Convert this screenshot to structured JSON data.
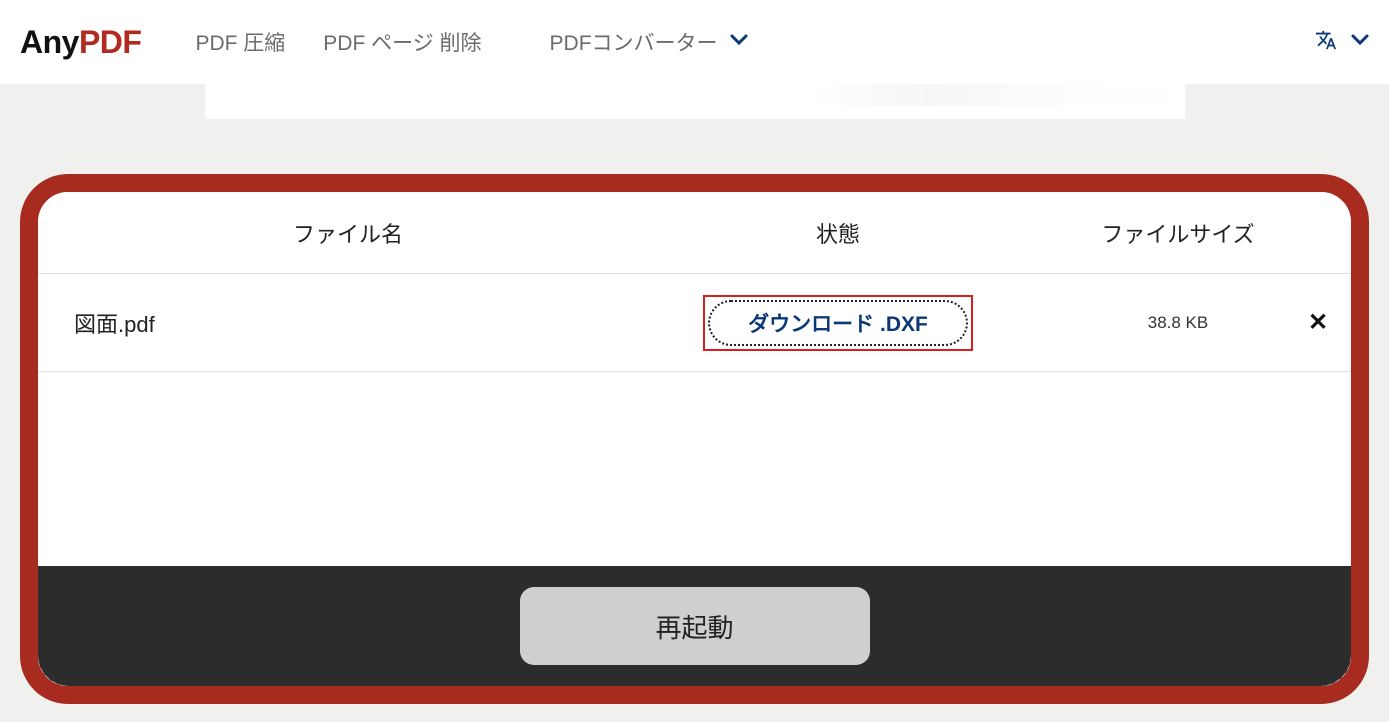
{
  "logo": {
    "part1": "Any",
    "part2": "PDF"
  },
  "nav": {
    "compress": "PDF 圧縮",
    "delete_pages": "PDF ページ 削除",
    "converter": "PDFコンバーター"
  },
  "table": {
    "headers": {
      "filename": "ファイル名",
      "status": "状態",
      "filesize": "ファイルサイズ"
    },
    "rows": [
      {
        "filename": "図面.pdf",
        "download_label": "ダウンロード .DXF",
        "size": "38.8 KB"
      }
    ]
  },
  "footer": {
    "restart_label": "再起動"
  }
}
